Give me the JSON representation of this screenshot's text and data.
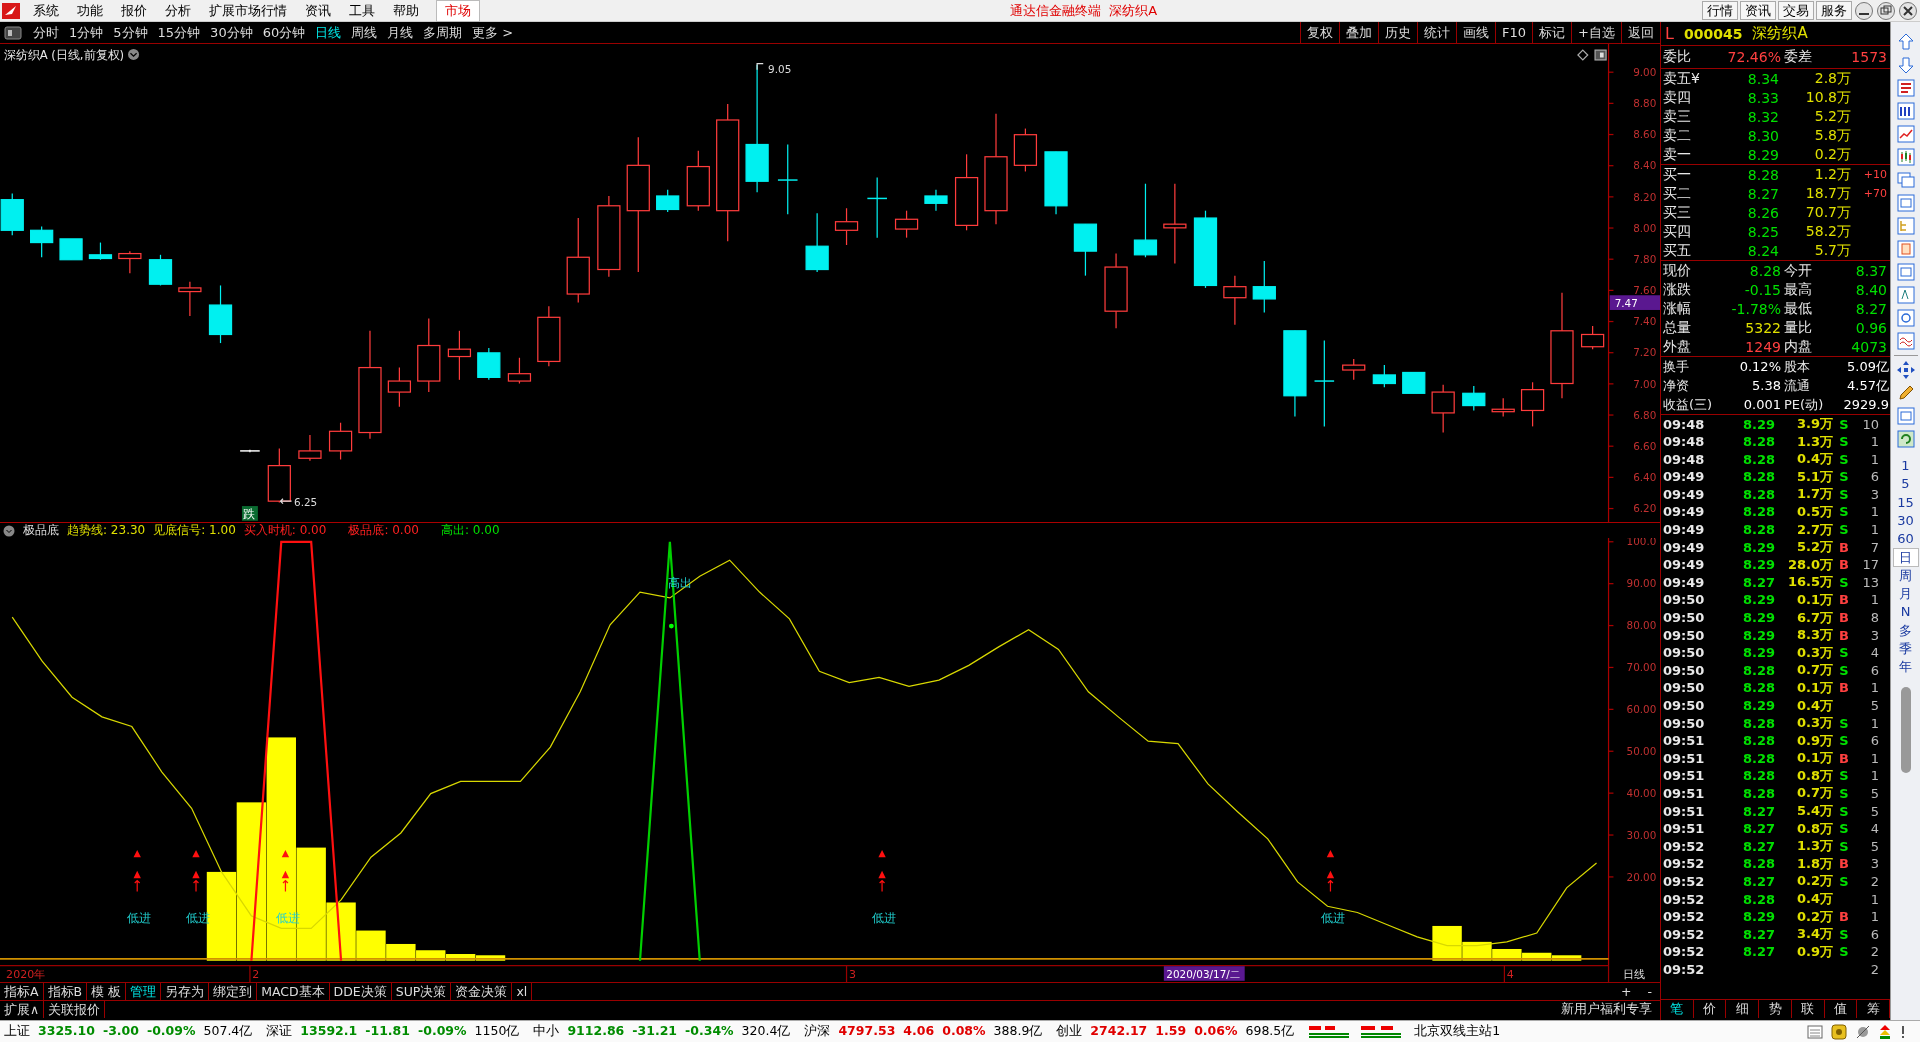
{
  "title_bar": {
    "menus": [
      "系统",
      "功能",
      "报价",
      "分析",
      "扩展市场行情",
      "资讯",
      "工具",
      "帮助"
    ],
    "market_tab": "市场",
    "title": "通达信金融终端  深纺织A",
    "buttons": [
      "行情",
      "资讯",
      "交易",
      "服务"
    ]
  },
  "period_bar": {
    "periods": [
      {
        "label": "分时",
        "selected": false
      },
      {
        "label": "1分钟",
        "selected": false
      },
      {
        "label": "5分钟",
        "selected": false
      },
      {
        "label": "15分钟",
        "selected": false
      },
      {
        "label": "30分钟",
        "selected": false
      },
      {
        "label": "60分钟",
        "selected": false
      },
      {
        "label": "日线",
        "selected": true
      },
      {
        "label": "周线",
        "selected": false
      },
      {
        "label": "月线",
        "selected": false
      },
      {
        "label": "多周期",
        "selected": false
      },
      {
        "label": "更多 >",
        "selected": false
      }
    ],
    "tools": [
      "复权",
      "叠加",
      "历史",
      "统计",
      "画线",
      "F10",
      "标记",
      "+自选",
      "返回"
    ]
  },
  "price_chart": {
    "title": "深纺织A (日线,前复权)",
    "price_axis": [
      "9.00",
      "8.80",
      "8.60",
      "8.40",
      "8.20",
      "8.00",
      "7.80",
      "7.60",
      "7.40",
      "7.20",
      "7.00",
      "6.80",
      "6.60",
      "6.40",
      "6.20"
    ],
    "current_price": "7.47",
    "high_label": "9.05",
    "low_label": "6.25",
    "signal": "跌"
  },
  "indicator": {
    "name": "极品底",
    "legend": [
      {
        "label": "趋势线: 23.30",
        "color": "#e0e000"
      },
      {
        "label": "见底信号: 1.00",
        "color": "#e0e000"
      },
      {
        "label": "买入时机: 0.00",
        "color": "#ff2020"
      },
      {
        "label": "极品底: 0.00",
        "color": "#ff2020"
      },
      {
        "label": "高出: 0.00",
        "color": "#00e000"
      }
    ],
    "chart_data": {
      "type": "line",
      "ylim": [
        0,
        100.9
      ],
      "yticks": [
        {
          "value": 100,
          "label": "100.0"
        },
        {
          "value": 90,
          "label": "90.00"
        },
        {
          "value": 80,
          "label": "80.00"
        },
        {
          "value": 70,
          "label": "70.00"
        },
        {
          "value": 60,
          "label": "60.00"
        },
        {
          "value": 50,
          "label": "50.00"
        },
        {
          "value": 40,
          "label": "40.00"
        },
        {
          "value": 30,
          "label": "30.00"
        },
        {
          "value": 20,
          "label": "20.00"
        }
      ],
      "series": [
        {
          "color": "#d8d800",
          "values": [
            82.0,
            71.5,
            62.9,
            58.2,
            55.9,
            45.1,
            36.4,
            21.2,
            10.7,
            7.7,
            7.7,
            14.5,
            24.7,
            30.5,
            39.9,
            42.8,
            42.8,
            42.8,
            51.0,
            64.2,
            80.2,
            88.0,
            86.6,
            91.8,
            95.6,
            88.0,
            81.6,
            69.1,
            66.4,
            67.6,
            65.5,
            67.0,
            70.5,
            74.9,
            79.0,
            74.3,
            64.2,
            58.2,
            52.4,
            51.8,
            42.2,
            35.5,
            29.1,
            18.8,
            13.0,
            11.5,
            8.6,
            5.7,
            3.6,
            3.6,
            4.5,
            6.6,
            17.4,
            23.3
          ]
        },
        {
          "color": "#ffff00",
          "type": "bar",
          "values": [
            0,
            0,
            0,
            0,
            0,
            0,
            0,
            21.2,
            37.8,
            53.3,
            27.0,
            13.9,
            7.2,
            4.0,
            2.5,
            1.6,
            1.3,
            0,
            0,
            0,
            0,
            0,
            0,
            0,
            0,
            0,
            0,
            0,
            0,
            0,
            0,
            0,
            0,
            0,
            0,
            0,
            0,
            0,
            0,
            0,
            0,
            0,
            0,
            0,
            0,
            0,
            0,
            0,
            8.3,
            4.5,
            2.8,
            1.9,
            1.3,
            0
          ]
        },
        {
          "color": "#ff1010",
          "values": [
            null,
            null,
            null,
            null,
            null,
            null,
            null,
            null,
            0,
            100,
            100,
            0,
            null,
            null,
            null,
            null,
            null,
            null,
            null,
            null,
            null,
            null,
            null,
            null,
            null,
            null,
            null,
            null,
            null,
            null,
            null,
            null,
            null,
            null,
            null,
            null,
            null,
            null,
            null,
            null,
            null,
            null,
            null,
            null,
            null,
            null,
            null,
            null,
            null,
            null,
            null,
            null,
            null,
            null
          ]
        },
        {
          "color": "#00d000",
          "values": [
            null,
            null,
            null,
            null,
            null,
            null,
            null,
            null,
            null,
            null,
            null,
            null,
            null,
            null,
            null,
            null,
            null,
            null,
            null,
            null,
            null,
            0,
            100,
            0,
            null,
            null,
            null,
            null,
            null,
            null,
            null,
            null,
            null,
            null,
            null,
            null,
            null,
            null,
            null,
            null,
            null,
            null,
            null,
            null,
            null,
            null,
            null,
            null,
            null,
            null,
            null,
            null,
            null,
            null
          ]
        }
      ]
    },
    "peak_label": "高出",
    "signals": [
      "低进",
      "低进",
      "低进",
      "低进",
      "低进"
    ]
  },
  "date_axis": {
    "labels": [
      "2020年",
      "2",
      "3",
      "4"
    ],
    "cursor_date": "2020/03/17/二",
    "period": "日线"
  },
  "indicator_tabs": [
    {
      "label": "指标A",
      "selected": false
    },
    {
      "label": "指标B",
      "selected": false
    },
    {
      "label": "模 板",
      "selected": false
    },
    {
      "label": "管理",
      "selected": true
    },
    {
      "label": "另存为",
      "selected": false
    },
    {
      "label": "绑定到",
      "selected": false
    },
    {
      "label": "MACD基本",
      "selected": false
    },
    {
      "label": "DDE决策",
      "selected": false
    },
    {
      "label": "SUP决策",
      "selected": false
    },
    {
      "label": "资金决策",
      "selected": false
    },
    {
      "label": "xl",
      "selected": false
    }
  ],
  "zoom_buttons": [
    "+",
    "-"
  ],
  "extra_tabs": [
    "扩展∧",
    "关联报价"
  ],
  "promo": "新用户福利专享",
  "quote": {
    "market": "L",
    "code": "000045",
    "name": "深纺织A",
    "ratio": [
      {
        "label": "委比",
        "value": "72.46%"
      },
      {
        "label": "委差",
        "value": "1573"
      }
    ],
    "asks": [
      {
        "label": "卖五¥",
        "price": "8.34",
        "volume": "2.8万"
      },
      {
        "label": "卖四",
        "price": "8.33",
        "volume": "10.8万"
      },
      {
        "label": "卖三",
        "price": "8.32",
        "volume": "5.2万"
      },
      {
        "label": "卖二",
        "price": "8.30",
        "volume": "5.8万"
      },
      {
        "label": "卖一",
        "price": "8.29",
        "volume": "0.2万"
      }
    ],
    "bids": [
      {
        "label": "买一",
        "price": "8.28",
        "volume": "1.2万",
        "change": "+10"
      },
      {
        "label": "买二",
        "price": "8.27",
        "volume": "18.7万",
        "change": "+70"
      },
      {
        "label": "买三",
        "price": "8.26",
        "volume": "70.7万"
      },
      {
        "label": "买四",
        "price": "8.25",
        "volume": "58.2万"
      },
      {
        "label": "买五",
        "price": "8.24",
        "volume": "5.7万"
      }
    ],
    "stats": [
      {
        "label": "现价",
        "value": "8.28",
        "color": "#00e000"
      },
      {
        "label": "今开",
        "value": "8.37",
        "color": "#00e000"
      },
      {
        "label": "涨跌",
        "value": "-0.15",
        "color": "#00e000"
      },
      {
        "label": "最高",
        "value": "8.40",
        "color": "#00e000"
      },
      {
        "label": "涨幅",
        "value": "-1.78%",
        "color": "#00e000"
      },
      {
        "label": "最低",
        "value": "8.27",
        "color": "#00e000"
      },
      {
        "label": "总量",
        "value": "5322",
        "color": "#e0e000"
      },
      {
        "label": "量比",
        "value": "0.96",
        "color": "#00e000"
      },
      {
        "label": "外盘",
        "value": "1249",
        "color": "#ff4040"
      },
      {
        "label": "内盘",
        "value": "4073",
        "color": "#00e000"
      }
    ],
    "fundamentals": [
      {
        "label": "换手",
        "value": "0.12%"
      },
      {
        "label": "股本",
        "value": "5.09亿"
      },
      {
        "label": "净资",
        "value": "5.38"
      },
      {
        "label": "流通",
        "value": "4.57亿"
      },
      {
        "label": "收益(三)",
        "value": "0.001"
      },
      {
        "label": "PE(动)",
        "value": "2929.9"
      }
    ]
  },
  "trades": [
    {
      "time": "09:48",
      "price": "8.29",
      "volume": "3.9万",
      "side": "S",
      "kind": "sell",
      "count": "10"
    },
    {
      "time": "09:48",
      "price": "8.28",
      "volume": "1.3万",
      "side": "S",
      "kind": "sell",
      "count": "1"
    },
    {
      "time": "09:48",
      "price": "8.28",
      "volume": "0.4万",
      "side": "S",
      "kind": "sell",
      "count": "1"
    },
    {
      "time": "09:49",
      "price": "8.28",
      "volume": "5.1万",
      "side": "S",
      "kind": "sell",
      "count": "6"
    },
    {
      "time": "09:49",
      "price": "8.28",
      "volume": "1.7万",
      "side": "S",
      "kind": "sell",
      "count": "3"
    },
    {
      "time": "09:49",
      "price": "8.28",
      "volume": "0.5万",
      "side": "S",
      "kind": "sell",
      "count": "1"
    },
    {
      "time": "09:49",
      "price": "8.28",
      "volume": "2.7万",
      "side": "S",
      "kind": "sell",
      "count": "1"
    },
    {
      "time": "09:49",
      "price": "8.29",
      "volume": "5.2万",
      "side": "B",
      "kind": "buy",
      "count": "7"
    },
    {
      "time": "09:49",
      "price": "8.29",
      "volume": "28.0万",
      "side": "B",
      "kind": "buy",
      "count": "17"
    },
    {
      "time": "09:49",
      "price": "8.27",
      "volume": "16.5万",
      "side": "S",
      "kind": "sell",
      "count": "13"
    },
    {
      "time": "09:50",
      "price": "8.29",
      "volume": "0.1万",
      "side": "B",
      "kind": "buy",
      "count": "1"
    },
    {
      "time": "09:50",
      "price": "8.29",
      "volume": "6.7万",
      "side": "B",
      "kind": "buy",
      "count": "8"
    },
    {
      "time": "09:50",
      "price": "8.29",
      "volume": "8.3万",
      "side": "B",
      "kind": "buy",
      "count": "3"
    },
    {
      "time": "09:50",
      "price": "8.29",
      "volume": "0.3万",
      "side": "S",
      "kind": "sell",
      "count": "4"
    },
    {
      "time": "09:50",
      "price": "8.28",
      "volume": "0.7万",
      "side": "S",
      "kind": "sell",
      "count": "6"
    },
    {
      "time": "09:50",
      "price": "8.28",
      "volume": "0.1万",
      "side": "B",
      "kind": "buy",
      "count": "1"
    },
    {
      "time": "09:50",
      "price": "8.29",
      "volume": "0.4万",
      "count": "5"
    },
    {
      "time": "09:50",
      "price": "8.28",
      "volume": "0.3万",
      "side": "S",
      "kind": "sell",
      "count": "1"
    },
    {
      "time": "09:51",
      "price": "8.28",
      "volume": "0.9万",
      "side": "S",
      "kind": "sell",
      "count": "6"
    },
    {
      "time": "09:51",
      "price": "8.28",
      "volume": "0.1万",
      "side": "B",
      "kind": "buy",
      "count": "1"
    },
    {
      "time": "09:51",
      "price": "8.28",
      "volume": "0.8万",
      "side": "S",
      "kind": "sell",
      "count": "1"
    },
    {
      "time": "09:51",
      "price": "8.28",
      "volume": "0.7万",
      "side": "S",
      "kind": "sell",
      "count": "5"
    },
    {
      "time": "09:51",
      "price": "8.27",
      "volume": "5.4万",
      "side": "S",
      "kind": "sell",
      "count": "5"
    },
    {
      "time": "09:51",
      "price": "8.27",
      "volume": "0.8万",
      "side": "S",
      "kind": "sell",
      "count": "4"
    },
    {
      "time": "09:52",
      "price": "8.27",
      "volume": "1.3万",
      "side": "S",
      "kind": "sell",
      "count": "5"
    },
    {
      "time": "09:52",
      "price": "8.28",
      "volume": "1.8万",
      "side": "B",
      "kind": "buy",
      "count": "3"
    },
    {
      "time": "09:52",
      "price": "8.27",
      "volume": "0.2万",
      "side": "S",
      "kind": "sell",
      "count": "2"
    },
    {
      "time": "09:52",
      "price": "8.28",
      "volume": "0.4万",
      "count": "1"
    },
    {
      "time": "09:52",
      "price": "8.29",
      "volume": "0.2万",
      "side": "B",
      "kind": "buy",
      "count": "1"
    },
    {
      "time": "09:52",
      "price": "8.27",
      "volume": "3.4万",
      "side": "S",
      "kind": "sell",
      "count": "6"
    },
    {
      "time": "09:52",
      "price": "8.27",
      "volume": "0.9万",
      "side": "S",
      "kind": "sell",
      "count": "2"
    },
    {
      "time": "09:52",
      "count": "2"
    }
  ],
  "panel_tabs": [
    {
      "label": "笔",
      "selected": true
    },
    {
      "label": "价",
      "selected": false
    },
    {
      "label": "细",
      "selected": false
    },
    {
      "label": "势",
      "selected": false
    },
    {
      "label": "联",
      "selected": false
    },
    {
      "label": "值",
      "selected": false
    },
    {
      "label": "筹",
      "selected": false
    }
  ],
  "side_periods": [
    {
      "label": "1",
      "selected": false
    },
    {
      "label": "5",
      "selected": false
    },
    {
      "label": "15",
      "selected": false
    },
    {
      "label": "30",
      "selected": false
    },
    {
      "label": "60",
      "selected": false
    },
    {
      "label": "日",
      "selected": true
    },
    {
      "label": "周",
      "selected": false
    },
    {
      "label": "月",
      "selected": false
    },
    {
      "label": "N",
      "selected": false
    },
    {
      "label": "多",
      "selected": false
    },
    {
      "label": "季",
      "selected": false
    },
    {
      "label": "年",
      "selected": false
    }
  ],
  "status_bar": {
    "indices": [
      {
        "name": "上证",
        "value": "3325.10",
        "change": "-3.00",
        "percent": "-0.09%",
        "amount": "507.4亿",
        "color": "#008c00"
      },
      {
        "name": "深证",
        "value": "13592.1",
        "change": "-11.81",
        "percent": "-0.09%",
        "amount": "1150亿",
        "color": "#008c00"
      },
      {
        "name": "中小",
        "value": "9112.86",
        "change": "-31.21",
        "percent": "-0.34%",
        "amount": "320.4亿",
        "color": "#008c00"
      },
      {
        "name": "沪深",
        "value": "4797.53",
        "change": "4.06",
        "percent": "0.08%",
        "amount": "388.9亿",
        "color": "#e00000"
      },
      {
        "name": "创业",
        "value": "2742.17",
        "change": "1.59",
        "percent": "0.06%",
        "amount": "698.5亿",
        "color": "#e00000"
      }
    ],
    "server": "北京双线主站1"
  }
}
